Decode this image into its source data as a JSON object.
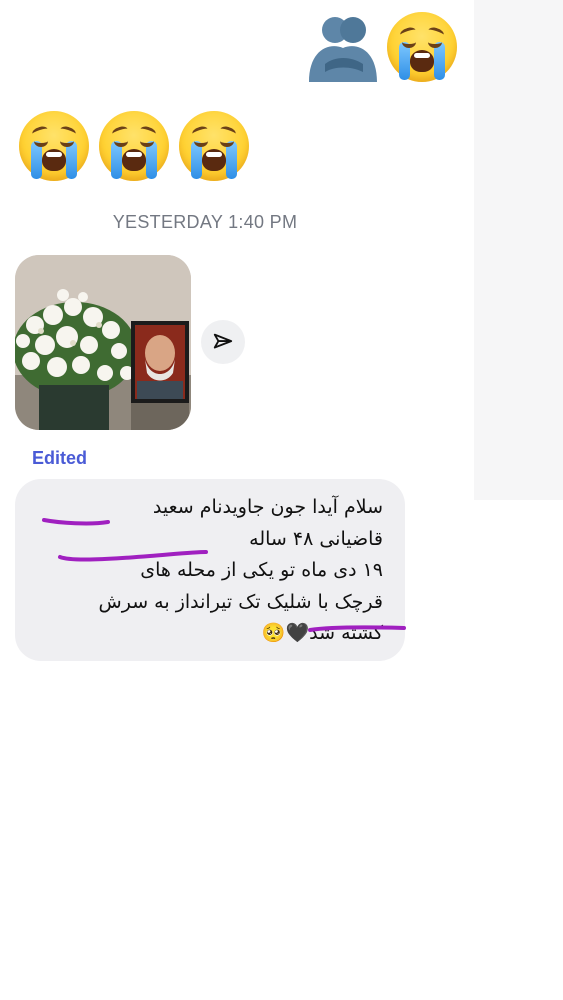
{
  "conversation": {
    "timestamp": "YESTERDAY 1:40 PM",
    "edited_label": "Edited",
    "sent_message": {
      "emojis": [
        "people-hugging-emoji",
        "loudly-crying-face-emoji"
      ]
    },
    "received_message": {
      "emojis": [
        "loudly-crying-face-emoji",
        "loudly-crying-face-emoji",
        "loudly-crying-face-emoji"
      ]
    },
    "photo": {
      "description_icon": "memorial-photo-with-flowers"
    },
    "share_icon": "paper-plane-icon",
    "message": {
      "lines": [
        "سلام آیدا جون جاویدنام سعید",
        "قاضیانی ۴۸ ساله",
        "۱۹ دی ماه تو یکی از محله های",
        "قرچک با شلیک تک تیرانداز به سرش",
        "کشته شد🖤🥺"
      ]
    },
    "annotation_color": "#a020c0"
  },
  "colors": {
    "bubble": "#efeff2",
    "timestamp": "#737882",
    "edited": "#4a5bd6"
  }
}
